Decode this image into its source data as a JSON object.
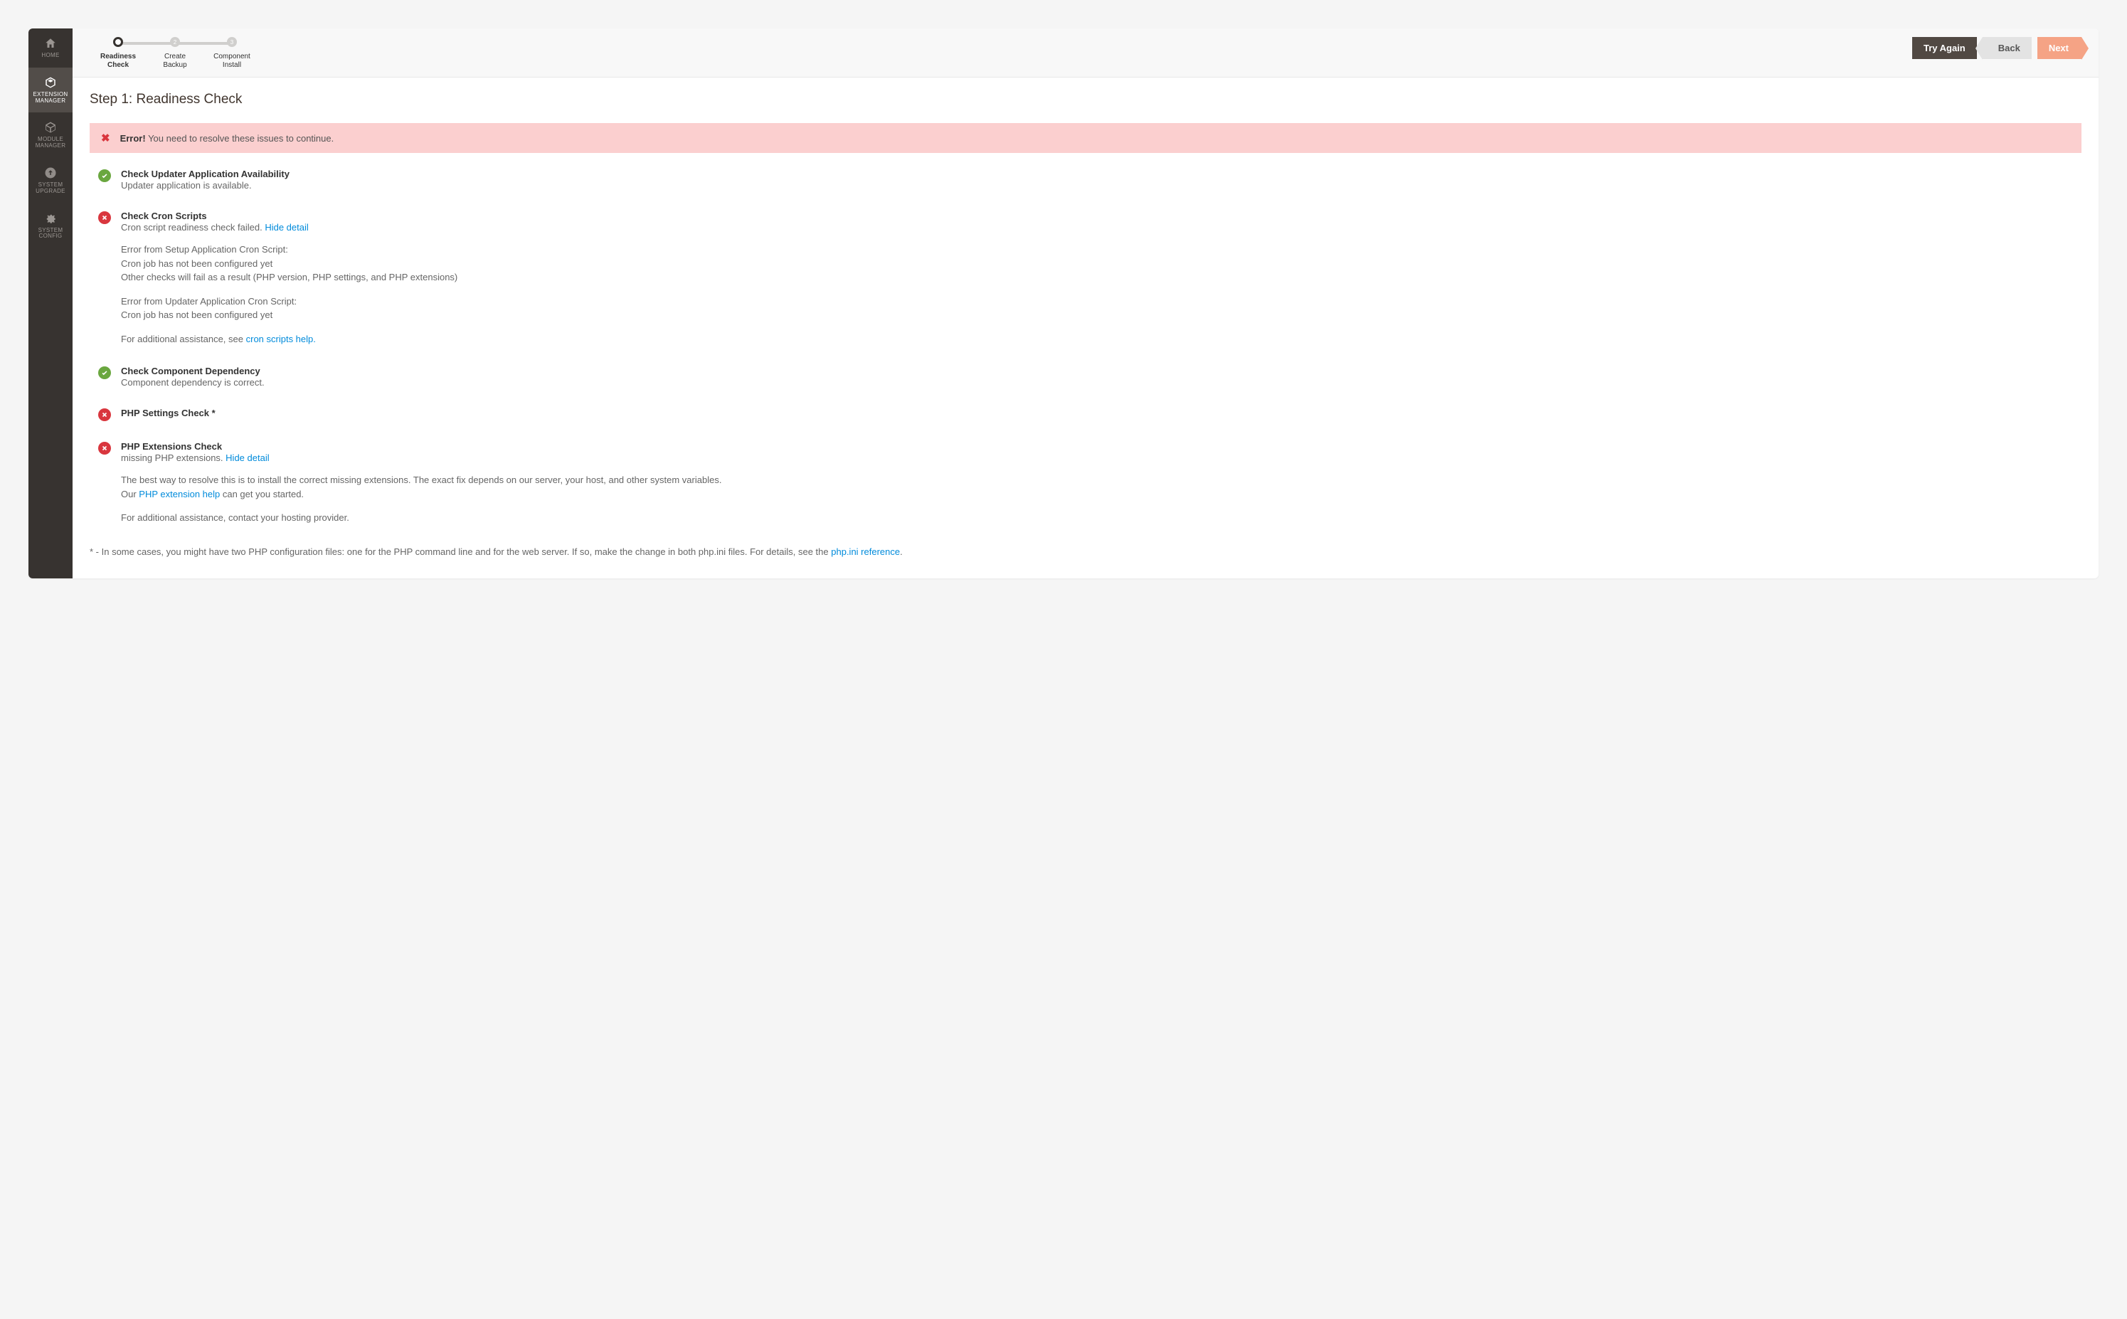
{
  "sidebar": {
    "items": [
      {
        "label": "HOME"
      },
      {
        "label": "EXTENSION\nMANAGER"
      },
      {
        "label": "MODULE\nMANAGER"
      },
      {
        "label": "SYSTEM\nUPGRADE"
      },
      {
        "label": "SYSTEM\nCONFIG"
      }
    ]
  },
  "steps": {
    "items": [
      {
        "num": "",
        "label": "Readiness\nCheck"
      },
      {
        "num": "2",
        "label": "Create\nBackup"
      },
      {
        "num": "3",
        "label": "Component\nInstall"
      }
    ]
  },
  "buttons": {
    "try_again": "Try Again",
    "back": "Back",
    "next": "Next"
  },
  "page": {
    "title": "Step 1: Readiness Check"
  },
  "alert": {
    "strong": "Error!",
    "text": " You need to resolve these issues to continue."
  },
  "checks": {
    "updater": {
      "title": "Check Updater Application Availability",
      "desc": "Updater application is available."
    },
    "cron": {
      "title": "Check Cron Scripts",
      "desc_prefix": "Cron script readiness check failed. ",
      "hide_link": "Hide detail",
      "detail1_l1": "Error from Setup Application Cron Script:",
      "detail1_l2": "Cron job has not been configured yet",
      "detail1_l3": "Other checks will fail as a result (PHP version, PHP settings, and PHP extensions)",
      "detail2_l1": "Error from Updater Application Cron Script:",
      "detail2_l2": "Cron job has not been configured yet",
      "detail3_prefix": "For additional assistance, see ",
      "detail3_link": "cron scripts help."
    },
    "dependency": {
      "title": "Check Component Dependency",
      "desc": "Component dependency is correct."
    },
    "php_settings": {
      "title": "PHP Settings Check *"
    },
    "php_ext": {
      "title": "PHP Extensions Check",
      "desc_prefix": "missing PHP extensions. ",
      "hide_link": "Hide detail",
      "detail1_l1": "The best way to resolve this is to install the correct missing extensions. The exact fix depends on our server, your host, and other system variables.",
      "detail1_l2_prefix": "Our ",
      "detail1_l2_link": "PHP extension help",
      "detail1_l2_suffix": " can get you started.",
      "detail2": "For additional assistance, contact your hosting provider."
    }
  },
  "footnote": {
    "prefix": "* - In some cases, you might have two PHP configuration files: one for the PHP command line and for the web server. If so, make the change in both php.ini files. For details, see the ",
    "link": "php.ini reference",
    "suffix": "."
  }
}
